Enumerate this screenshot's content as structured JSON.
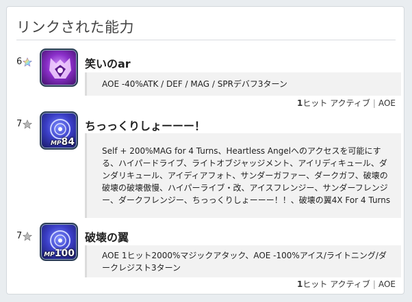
{
  "panel": {
    "title": "リンクされた能力"
  },
  "abilities": [
    {
      "rarity": "6",
      "name": "笑いのar",
      "description": "AOE -40%ATK / DEF / MAG / SPRデバフ3ターン",
      "footer": {
        "hits_num": "1",
        "hits_unit": "ヒット",
        "type": "アクティブ",
        "separator": "|",
        "target": "AOE"
      },
      "icon": "laughing-ar-icon"
    },
    {
      "rarity": "7",
      "name": "ちっっくりしょーーー！",
      "description": "Self + 200%MAG for 4 Turns、Heartless Angelへのアクセスを可能にする、ハイパードライブ、ライトオブジャッジメント、アイリディキュール、ダンダリキュール、アイディアフォト、サンダーガファー、ダークガフ、破壊の破壊の破壊傲慢、ハイパーライブ・改、アイスフレンジー、サンダーフレンジー、ダークフレンジー、ちっっくりしょーーー！！、破壊の翼4X For 4 Turns",
      "mp_label": "MP",
      "mp_cost": "84",
      "icon": "magic-sigil-icon"
    },
    {
      "rarity": "7",
      "name": "破壊の翼",
      "description": "AOE 1ヒット2000%マジックアタック、AOE -100%アイス/ライトニング/ダークレジスト3ターン",
      "footer": {
        "hits_num": "1",
        "hits_unit": "ヒット",
        "type": "アクティブ",
        "separator": "|",
        "target": "AOE"
      },
      "mp_label": "MP",
      "mp_cost": "100",
      "icon": "magic-sigil-icon"
    }
  ],
  "colors": {
    "rainbow_star": "#c8a0ff",
    "silver_star": "#a0a0a0"
  }
}
